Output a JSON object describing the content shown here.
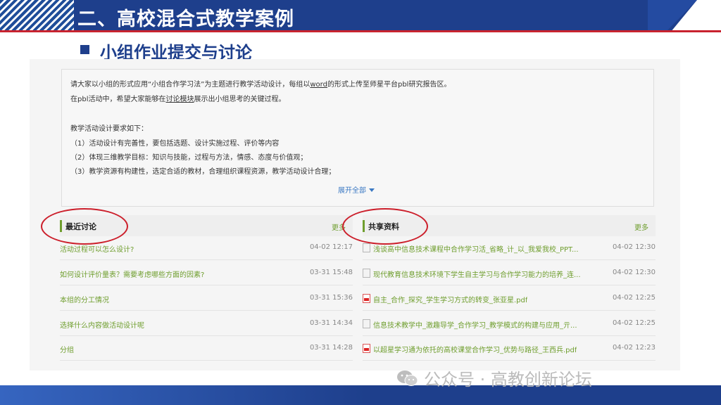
{
  "header": {
    "title": "二、高校混合式教学案例",
    "subtitle": "小组作业提交与讨论"
  },
  "description": {
    "line1_a": "请大家以小组的形式应用“小组合作学习法”为主题进行教学活动设计，每组以",
    "line1_link": "word",
    "line1_b": "的形式上传至师星平台pbl研究报告区。",
    "line2_a": "在pbl活动中，希望大家能够在",
    "line2_link": "讨论模块",
    "line2_b": "展示出小组思考的关键过程。",
    "line3": "教学活动设计要求如下：",
    "line4": "（1）活动设计有完善性，要包括选题、设计实施过程、评价等内容",
    "line5": "（2）体现三维教学目标：知识与技能，过程与方法，情感、态度与价值观；",
    "line6": "（3）教学资源有构建性，选定合适的教材，合理组织课程资源，教学活动设计合理；",
    "expand": "展开全部"
  },
  "discussion": {
    "title": "最近讨论",
    "more": "更多",
    "items": [
      {
        "text": "活动过程可以怎么设计?",
        "date": "04-02 12:17"
      },
      {
        "text": "如何设计评价量表？需要考虑哪些方面的因素?",
        "date": "03-31 15:48"
      },
      {
        "text": "本组的分工情况",
        "date": "03-31 15:36"
      },
      {
        "text": "选择什么内容做活动设计呢",
        "date": "03-31 14:34"
      },
      {
        "text": "分组",
        "date": "03-31 14:28"
      }
    ]
  },
  "resources": {
    "title": "共享资料",
    "more": "更多",
    "items": [
      {
        "text": "浅谈高中信息技术课程中合作学习活_省略_计_以_我爱我校_PPT...",
        "date": "04-02 12:30",
        "icon": "document-icon"
      },
      {
        "text": "现代教育信息技术环境下学生自主学习与合作学习能力的培养_连...",
        "date": "04-02 12:30",
        "icon": "document-icon"
      },
      {
        "text": "自主_合作_探究_学生学习方式的转变_张亚星.pdf",
        "date": "04-02 12:25",
        "icon": "pdf-icon"
      },
      {
        "text": "信息技术教学中_激趣导学_合作学习_教学模式的构建与应用_亓...",
        "date": "04-02 12:25",
        "icon": "document-icon"
      },
      {
        "text": "以超星学习通为依托的高校课堂合作学习_优势与路径_王西兵.pdf",
        "date": "04-02 12:23",
        "icon": "pdf-icon"
      }
    ]
  },
  "watermark": {
    "text": "公众号 · 高教创新论坛",
    "icon": "wechat-icon"
  },
  "colors": {
    "header_blue": "#1e3f8c",
    "accent_red": "#c8232f",
    "link_green": "#6f9e2e",
    "expand_blue": "#3a78c3"
  }
}
